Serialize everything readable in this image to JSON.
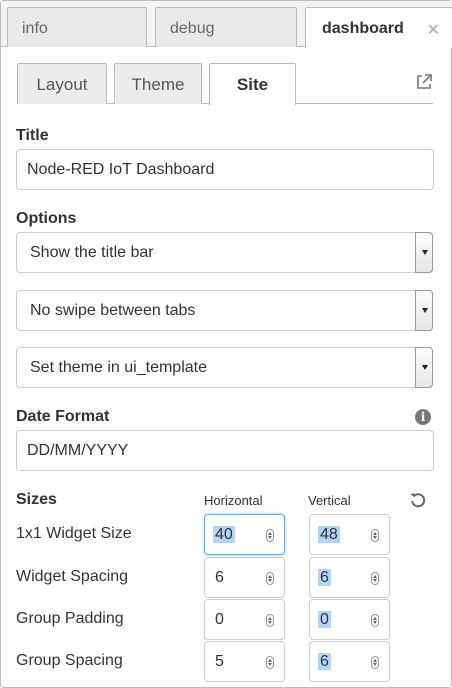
{
  "top_tabs": [
    {
      "label": "info"
    },
    {
      "label": "debug"
    },
    {
      "label": "dashboard"
    }
  ],
  "sub_tabs": [
    {
      "label": "Layout"
    },
    {
      "label": "Theme"
    },
    {
      "label": "Site"
    }
  ],
  "title_section": {
    "label": "Title",
    "value": "Node-RED IoT Dashboard"
  },
  "options": {
    "label": "Options",
    "selects": [
      {
        "value": "Show the title bar"
      },
      {
        "value": "No swipe between tabs"
      },
      {
        "value": "Set theme in ui_template"
      }
    ]
  },
  "date_format": {
    "label": "Date Format",
    "value": "DD/MM/YYYY"
  },
  "sizes": {
    "label": "Sizes",
    "horizontal_label": "Horizontal",
    "vertical_label": "Vertical",
    "rows": [
      {
        "label": "1x1 Widget Size",
        "horizontal": "40",
        "vertical": "48"
      },
      {
        "label": "Widget Spacing",
        "horizontal": "6",
        "vertical": "6"
      },
      {
        "label": "Group Padding",
        "horizontal": "0",
        "vertical": "0"
      },
      {
        "label": "Group Spacing",
        "horizontal": "5",
        "vertical": "6"
      }
    ]
  },
  "icons": {
    "close": "close-icon",
    "external_link": "external-link-icon",
    "info": "info-icon",
    "reset": "reset-icon",
    "select_caret": "chevron-down-icon",
    "spinner": "spinner-arrows-icon"
  },
  "colors": {
    "focus_border": "#6fa8dc",
    "selection": "#b3d4fc"
  }
}
